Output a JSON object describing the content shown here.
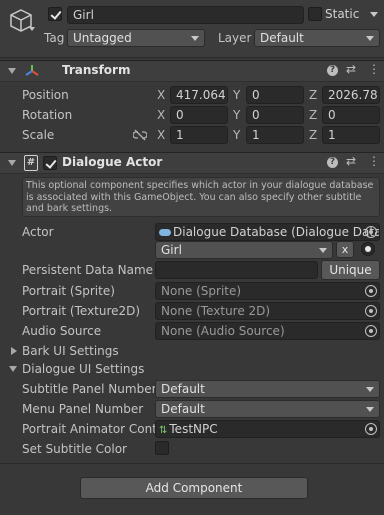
{
  "gameobject": {
    "name": "Girl",
    "static_label": "Static",
    "tag_label": "Tag",
    "tag_value": "Untagged",
    "layer_label": "Layer",
    "layer_value": "Default"
  },
  "transform": {
    "title": "Transform",
    "position_label": "Position",
    "rotation_label": "Rotation",
    "scale_label": "Scale",
    "axis_x": "X",
    "axis_y": "Y",
    "axis_z": "Z",
    "position": {
      "x": "417.064",
      "y": "0",
      "z": "2026.78"
    },
    "rotation": {
      "x": "0",
      "y": "0",
      "z": "0"
    },
    "scale": {
      "x": "1",
      "y": "1",
      "z": "1"
    }
  },
  "dialogue_actor": {
    "title": "Dialogue Actor",
    "description": "This optional component specifies which actor in your dialogue database is associated with this GameObject. You can also specify other subtitle and bark settings.",
    "actor_label": "Actor",
    "database_value": "Dialogue Database (Dialogue Data",
    "actor_value": "Girl",
    "clear_label": "x",
    "persistent_label": "Persistent Data Name",
    "persistent_value": "",
    "unique_label": "Unique",
    "portrait_sprite_label": "Portrait (Sprite)",
    "portrait_sprite_value": "None (Sprite)",
    "portrait_tex_label": "Portrait (Texture2D)",
    "portrait_tex_value": "None (Texture 2D)",
    "audio_label": "Audio Source",
    "audio_value": "None (Audio Source)",
    "bark_ui_label": "Bark UI Settings",
    "dialogue_ui_label": "Dialogue UI Settings",
    "subtitle_panel_label": "Subtitle Panel Number",
    "subtitle_panel_value": "Default",
    "menu_panel_label": "Menu Panel Number",
    "menu_panel_value": "Default",
    "portrait_anim_label": "Portrait Animator Contr",
    "portrait_anim_value": "TestNPC",
    "subtitle_color_label": "Set Subtitle Color"
  },
  "add_component_label": "Add Component",
  "colors": {
    "background": "#383838",
    "field": "#2a2a2a",
    "header": "#3e3e3e",
    "text": "#c4c4c4"
  }
}
